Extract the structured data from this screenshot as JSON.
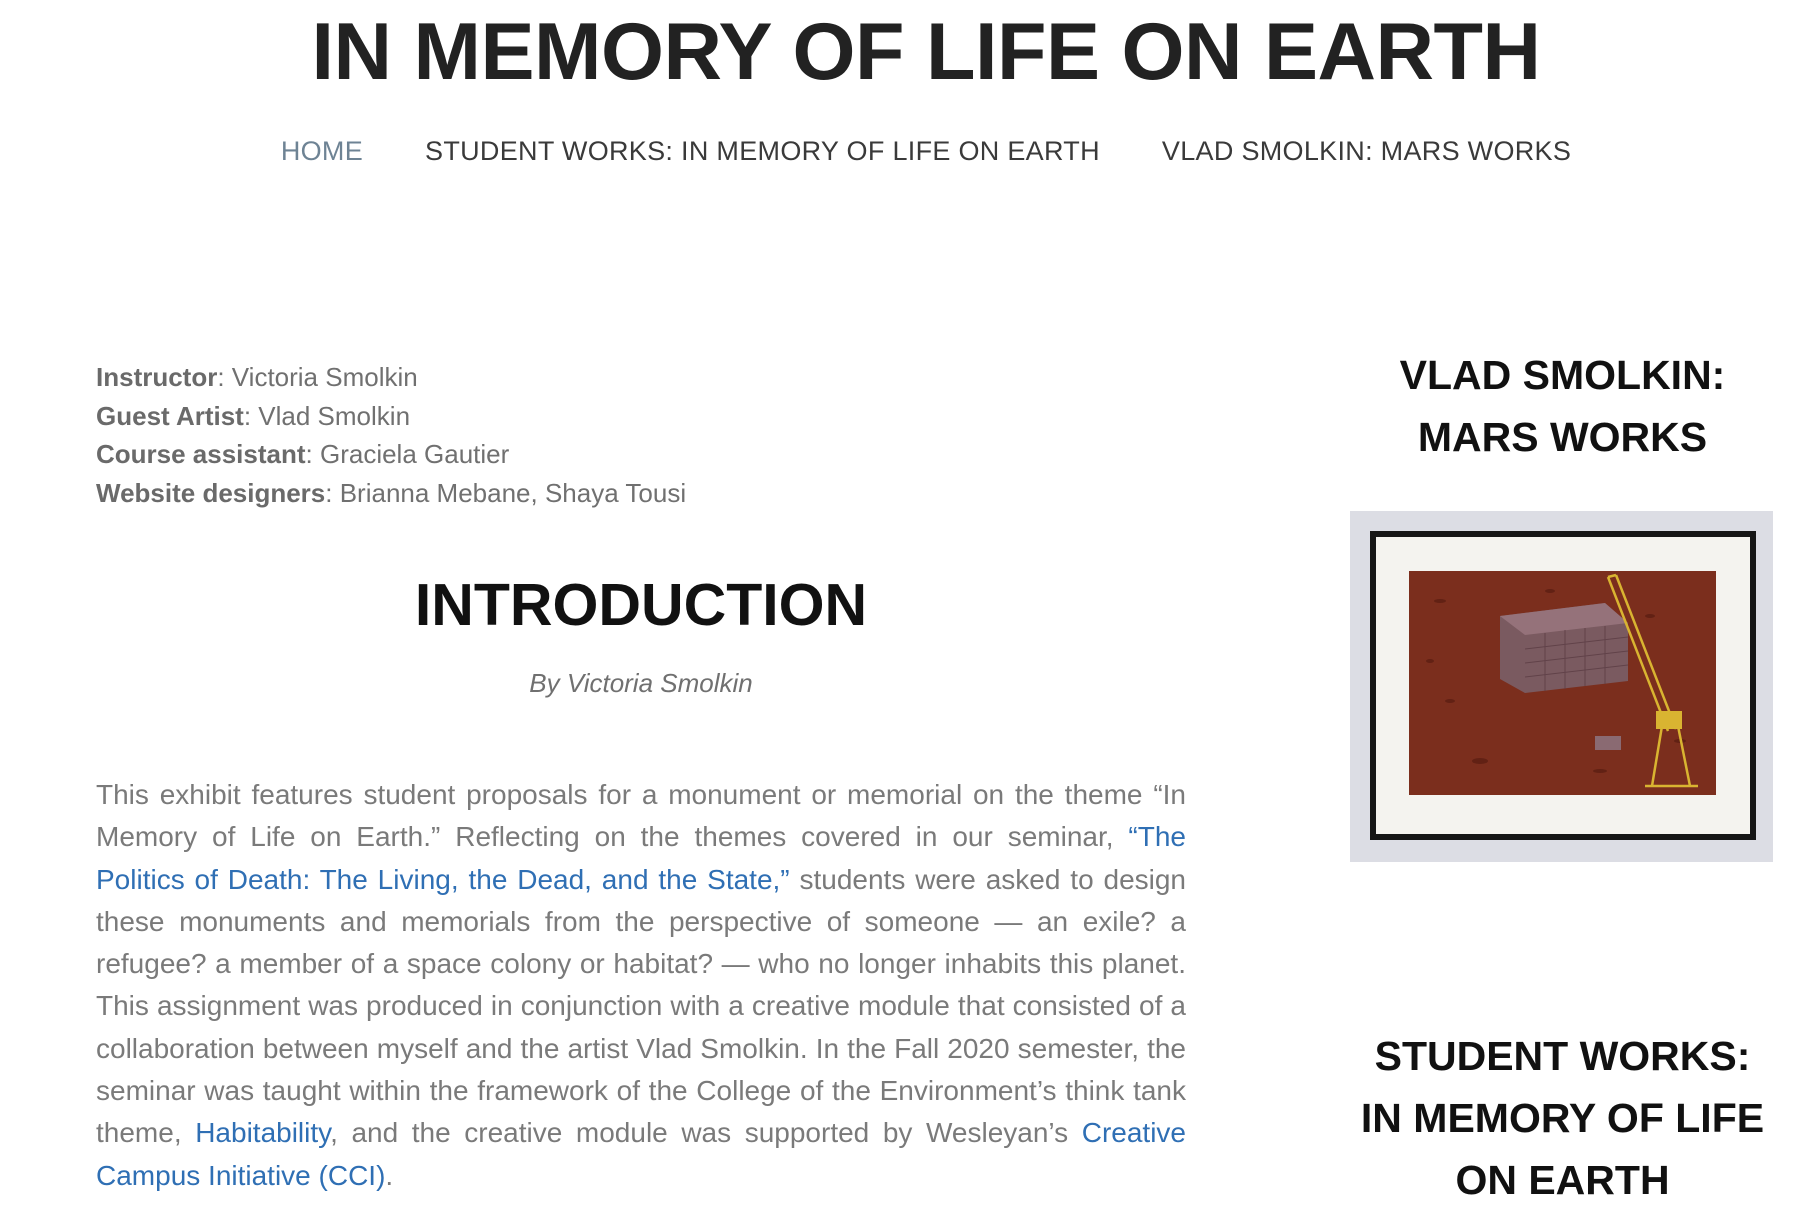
{
  "site": {
    "title": "IN MEMORY OF LIFE ON EARTH"
  },
  "nav": {
    "items": [
      {
        "label": "HOME",
        "active": true
      },
      {
        "label": "STUDENT WORKS: IN MEMORY OF LIFE ON EARTH",
        "active": false
      },
      {
        "label": "VLAD SMOLKIN: MARS WORKS",
        "active": false
      }
    ]
  },
  "credits": [
    {
      "role": "Instructor",
      "value": ": Victoria Smolkin"
    },
    {
      "role": "Guest Artist",
      "value": ": Vlad Smolkin"
    },
    {
      "role": "Course assistant",
      "value": ": Graciela Gautier"
    },
    {
      "role": "Website designers",
      "value": ": Brianna Mebane, Shaya Tousi"
    }
  ],
  "intro": {
    "heading": "INTRODUCTION",
    "byline": "By Victoria Smolkin",
    "p1": "This exhibit features student proposals for a monument or memorial on the theme “In Memory of Life on Earth.” Reflecting on the themes covered in our seminar, ",
    "link1": "“The Politics of Death: The Living, the Dead, and the State,”",
    "p2": " students were asked to design these monuments and memorials from the perspective of someone — an exile? a refugee? a member of a space colony or habitat? — who no longer inhabits this planet. This assignment was produced in conjunction with a creative module that consisted of a collaboration between myself and the artist Vlad Smolkin. In the Fall 2020 semester, the seminar was taught within the framework of the College of the Environment’s think tank theme, ",
    "link2": "Habitability",
    "p3": ", and the creative module was supported by Wesleyan’s ",
    "link3": "Creative Campus Initiative (CCI)",
    "p4": "."
  },
  "sidebar": {
    "widget1_title": "VLAD SMOLKIN: MARS WORKS",
    "widget2_title": "STUDENT WORKS: IN MEMORY OF LIFE ON EARTH",
    "artwork_icon": "framed-mars-painting-with-crane-and-brick-wall"
  },
  "colors": {
    "link": "#2f6fb4",
    "nav_active": "#6e8394",
    "mars_red": "#7a2c1c",
    "crane_yellow": "#d9b431"
  }
}
